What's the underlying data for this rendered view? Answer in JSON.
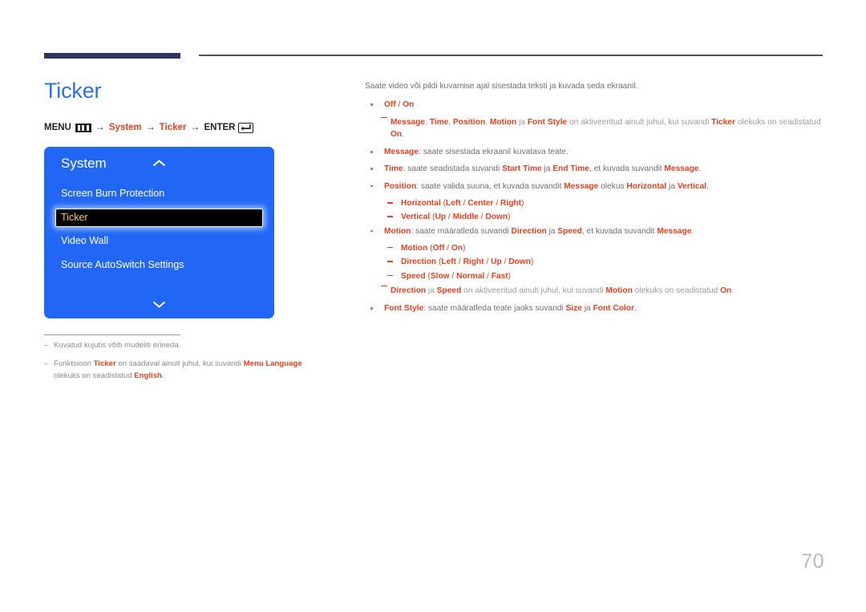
{
  "header": {
    "accent_color": "#2e3460",
    "rule_color": "#4a4f72"
  },
  "page": {
    "title": "Ticker",
    "title_color": "#2a72e0",
    "number": "70"
  },
  "breadcrumb": {
    "menu_label": "MENU",
    "menu_icon": "menu-bars-icon",
    "step1": "System",
    "step2": "Ticker",
    "enter_label": "ENTER",
    "enter_icon": "enter-key-icon",
    "arrow": "→"
  },
  "osd": {
    "panel_color": "#2266f5",
    "title": "System",
    "chevron_up_icon": "chevron-up-icon",
    "chevron_down_icon": "chevron-down-icon",
    "selected_index": 1,
    "selected_text_color": "#ffcc33",
    "items": [
      {
        "label": "Screen Burn Protection"
      },
      {
        "label": "Ticker"
      },
      {
        "label": "Video Wall"
      },
      {
        "label": "Source AutoSwitch Settings"
      }
    ]
  },
  "left_notes": [
    {
      "parts": [
        {
          "t": "Kuvatud kujutis võib mudeliti erineda.",
          "s": "n"
        }
      ]
    },
    {
      "parts": [
        {
          "t": "Funktsioon ",
          "s": "n"
        },
        {
          "t": "Ticker",
          "s": "b"
        },
        {
          "t": " on saadaval ainult juhul, kui suvandi ",
          "s": "n"
        },
        {
          "t": "Menu Language",
          "s": "b"
        },
        {
          "t": " olekuks on seadistatud ",
          "s": "n"
        },
        {
          "t": "English",
          "s": "b"
        },
        {
          "t": ".",
          "s": "n"
        }
      ]
    }
  ],
  "content": {
    "intro": "Saate video või pildi kuvamise ajal sisestada teksti ja kuvada seda ekraanil.",
    "blocks": [
      {
        "kind": "bullet",
        "parts": [
          {
            "t": "Off",
            "s": "b"
          },
          {
            "t": " / ",
            "s": "r"
          },
          {
            "t": "On",
            "s": "b"
          }
        ]
      },
      {
        "kind": "subnote",
        "parts": [
          {
            "t": "Message",
            "s": "b"
          },
          {
            "t": ", ",
            "s": "n"
          },
          {
            "t": "Time",
            "s": "b"
          },
          {
            "t": ", ",
            "s": "n"
          },
          {
            "t": "Position",
            "s": "b"
          },
          {
            "t": ", ",
            "s": "n"
          },
          {
            "t": "Motion",
            "s": "b"
          },
          {
            "t": " ja ",
            "s": "n"
          },
          {
            "t": "Font Style",
            "s": "b"
          },
          {
            "t": " on aktiveeritud ainult juhul, kui suvandi ",
            "s": "n"
          },
          {
            "t": "Ticker",
            "s": "b"
          },
          {
            "t": " olekuks on seadistatud ",
            "s": "n"
          },
          {
            "t": "On",
            "s": "b"
          },
          {
            "t": ".",
            "s": "n"
          }
        ]
      },
      {
        "kind": "bullet",
        "parts": [
          {
            "t": "Message",
            "s": "b"
          },
          {
            "t": ": saate sisestada ekraanil kuvatava teate.",
            "s": "n"
          }
        ]
      },
      {
        "kind": "bullet",
        "parts": [
          {
            "t": "Time",
            "s": "b"
          },
          {
            "t": ": saate seadistada suvandi ",
            "s": "n"
          },
          {
            "t": "Start Time",
            "s": "b"
          },
          {
            "t": " ja ",
            "s": "n"
          },
          {
            "t": "End Time",
            "s": "b"
          },
          {
            "t": ", et kuvada suvandit ",
            "s": "n"
          },
          {
            "t": "Message",
            "s": "b"
          },
          {
            "t": ".",
            "s": "n"
          }
        ]
      },
      {
        "kind": "bullet",
        "parts": [
          {
            "t": "Position",
            "s": "b"
          },
          {
            "t": ": saate valida suuna, et kuvada suvandit ",
            "s": "n"
          },
          {
            "t": "Message",
            "s": "b"
          },
          {
            "t": " olekus ",
            "s": "n"
          },
          {
            "t": "Horizontal",
            "s": "b"
          },
          {
            "t": " ja ",
            "s": "n"
          },
          {
            "t": "Vertical",
            "s": "b"
          },
          {
            "t": ".",
            "s": "n"
          }
        ]
      },
      {
        "kind": "subitem",
        "parts": [
          {
            "t": "Horizontal",
            "s": "b"
          },
          {
            "t": " (",
            "s": "r"
          },
          {
            "t": "Left",
            "s": "b"
          },
          {
            "t": " / ",
            "s": "r"
          },
          {
            "t": "Center",
            "s": "b"
          },
          {
            "t": " / ",
            "s": "r"
          },
          {
            "t": "Right",
            "s": "b"
          },
          {
            "t": ")",
            "s": "r"
          }
        ]
      },
      {
        "kind": "subitem",
        "parts": [
          {
            "t": "Vertical",
            "s": "b"
          },
          {
            "t": " (",
            "s": "r"
          },
          {
            "t": "Up",
            "s": "b"
          },
          {
            "t": " / ",
            "s": "r"
          },
          {
            "t": "Middle",
            "s": "b"
          },
          {
            "t": " / ",
            "s": "r"
          },
          {
            "t": "Down",
            "s": "b"
          },
          {
            "t": ")",
            "s": "r"
          }
        ]
      },
      {
        "kind": "bullet",
        "parts": [
          {
            "t": "Motion",
            "s": "b"
          },
          {
            "t": ": saate määratleda suvandi ",
            "s": "n"
          },
          {
            "t": "Direction",
            "s": "b"
          },
          {
            "t": " ja ",
            "s": "n"
          },
          {
            "t": "Speed",
            "s": "b"
          },
          {
            "t": ", et kuvada suvandit ",
            "s": "n"
          },
          {
            "t": "Message",
            "s": "b"
          },
          {
            "t": ".",
            "s": "n"
          }
        ]
      },
      {
        "kind": "subitem",
        "parts": [
          {
            "t": "Motion",
            "s": "b"
          },
          {
            "t": " (",
            "s": "r"
          },
          {
            "t": "Off",
            "s": "b"
          },
          {
            "t": " / ",
            "s": "r"
          },
          {
            "t": "On",
            "s": "b"
          },
          {
            "t": ")",
            "s": "r"
          }
        ]
      },
      {
        "kind": "subitem",
        "parts": [
          {
            "t": "Direction",
            "s": "b"
          },
          {
            "t": " (",
            "s": "r"
          },
          {
            "t": "Left",
            "s": "b"
          },
          {
            "t": " / ",
            "s": "r"
          },
          {
            "t": "Right",
            "s": "b"
          },
          {
            "t": " / ",
            "s": "r"
          },
          {
            "t": "Up",
            "s": "b"
          },
          {
            "t": " / ",
            "s": "r"
          },
          {
            "t": "Down",
            "s": "b"
          },
          {
            "t": ")",
            "s": "r"
          }
        ]
      },
      {
        "kind": "subitem",
        "parts": [
          {
            "t": "Speed",
            "s": "b"
          },
          {
            "t": " (",
            "s": "r"
          },
          {
            "t": "Slow",
            "s": "b"
          },
          {
            "t": " / ",
            "s": "r"
          },
          {
            "t": "Normal",
            "s": "b"
          },
          {
            "t": " / ",
            "s": "r"
          },
          {
            "t": "Fast",
            "s": "b"
          },
          {
            "t": ")",
            "s": "r"
          }
        ]
      },
      {
        "kind": "subnote",
        "parts": [
          {
            "t": "Direction",
            "s": "b"
          },
          {
            "t": " ja ",
            "s": "n"
          },
          {
            "t": "Speed",
            "s": "b"
          },
          {
            "t": " on aktiveeritud ainult juhul, kui suvandi ",
            "s": "n"
          },
          {
            "t": "Motion",
            "s": "b"
          },
          {
            "t": " olekuks on seadistatud ",
            "s": "n"
          },
          {
            "t": "On",
            "s": "b"
          },
          {
            "t": ".",
            "s": "n"
          }
        ]
      },
      {
        "kind": "bullet",
        "parts": [
          {
            "t": "Font Style",
            "s": "b"
          },
          {
            "t": ": saate määratleda teate jaoks suvandi ",
            "s": "n"
          },
          {
            "t": "Size",
            "s": "b"
          },
          {
            "t": " ja ",
            "s": "n"
          },
          {
            "t": "Font Color",
            "s": "b"
          },
          {
            "t": ".",
            "s": "n"
          }
        ]
      }
    ]
  }
}
